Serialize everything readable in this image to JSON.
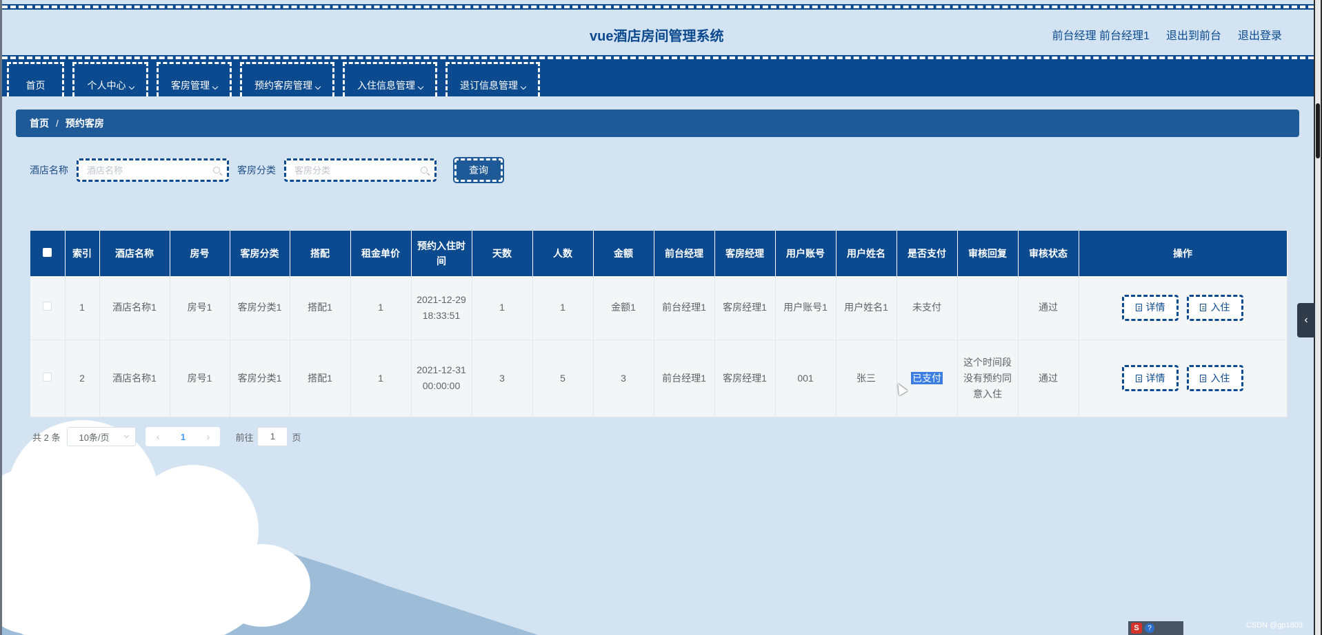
{
  "header": {
    "title": "vue酒店房间管理系统",
    "user_info": "前台经理 前台经理1",
    "back_to_front": "退出到前台",
    "logout": "退出登录"
  },
  "nav": [
    {
      "label": "首页",
      "dropdown": false
    },
    {
      "label": "个人中心",
      "dropdown": true
    },
    {
      "label": "客房管理",
      "dropdown": true
    },
    {
      "label": "预约客房管理",
      "dropdown": true
    },
    {
      "label": "入住信息管理",
      "dropdown": true
    },
    {
      "label": "退订信息管理",
      "dropdown": true
    }
  ],
  "breadcrumb": {
    "home": "首页",
    "separator": "/",
    "current": "预约客房"
  },
  "search": {
    "hotel_label": "酒店名称",
    "hotel_placeholder": "酒店名称",
    "category_label": "客房分类",
    "category_placeholder": "客房分类",
    "query_button": "查询"
  },
  "table": {
    "headers": [
      "索引",
      "酒店名称",
      "房号",
      "客房分类",
      "搭配",
      "租金单价",
      "预约入住时间",
      "天数",
      "人数",
      "金额",
      "前台经理",
      "客房经理",
      "用户账号",
      "用户姓名",
      "是否支付",
      "审核回复",
      "审核状态",
      "操作"
    ],
    "rows": [
      {
        "index": "1",
        "hotel": "酒店名称1",
        "room": "房号1",
        "category": "客房分类1",
        "combo": "搭配1",
        "price": "1",
        "checkin_time": "2021-12-29 18:33:51",
        "days": "1",
        "people": "1",
        "amount": "金额1",
        "front_manager": "前台经理1",
        "room_manager": "客房经理1",
        "account": "用户账号1",
        "username": "用户姓名1",
        "paid": "未支付",
        "reply": "",
        "status": "通过"
      },
      {
        "index": "2",
        "hotel": "酒店名称1",
        "room": "房号1",
        "category": "客房分类1",
        "combo": "搭配1",
        "price": "1",
        "checkin_time": "2021-12-31 00:00:00",
        "days": "3",
        "people": "5",
        "amount": "3",
        "front_manager": "前台经理1",
        "room_manager": "客房经理1",
        "account": "001",
        "username": "张三",
        "paid": "已支付",
        "reply": "这个时间段没有预约同意入住",
        "status": "通过"
      }
    ],
    "detail_button": "详情",
    "checkin_button": "入住"
  },
  "pagination": {
    "total": "共 2 条",
    "page_size": "10条/页",
    "current_page": "1",
    "goto_label": "前往",
    "goto_value": "1",
    "page_suffix": "页"
  },
  "watermark": "CSDN @gp1803",
  "colors": {
    "primary": "#0b4a8e",
    "breadcrumb": "#1f5a98",
    "background": "#d3e3f1",
    "highlight": "#3b7de1"
  }
}
